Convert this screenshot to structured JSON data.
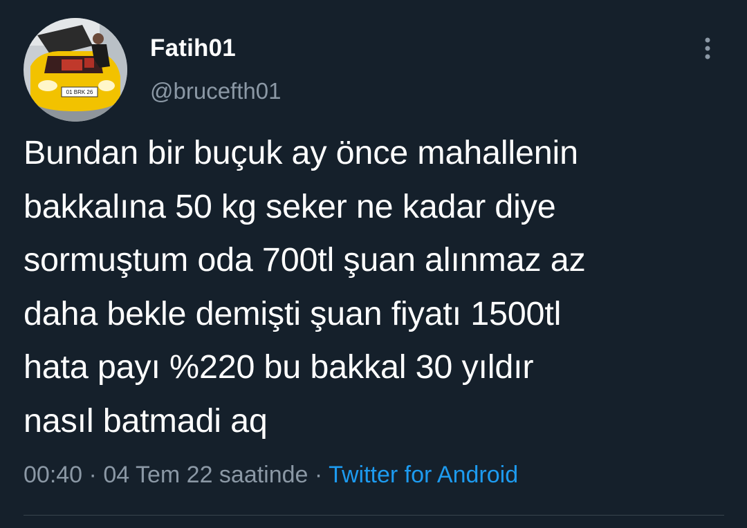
{
  "tweet": {
    "display_name": "Fatih01",
    "handle": "@brucefth01",
    "text": "Bundan bir buçuk ay önce mahallenin\nbakkalına 50 kg seker ne kadar diye\nsormuştum oda 700tl şuan alınmaz az\ndaha bekle demişti şuan fiyatı 1500tl\nhata payı %220 bu bakkal 30 yıldır\nnasıl batmadi aq",
    "time": "00:40",
    "separator": "·",
    "date": "04 Tem 22 saatinde",
    "source": "Twitter for Android",
    "avatar_plate": "01 BRK 26"
  },
  "icons": {
    "more": "more-vertical-icon"
  },
  "colors": {
    "background": "#15202b",
    "text": "#ffffff",
    "muted": "#8b98a5",
    "link": "#1d9bf0",
    "divider": "#38444d"
  }
}
